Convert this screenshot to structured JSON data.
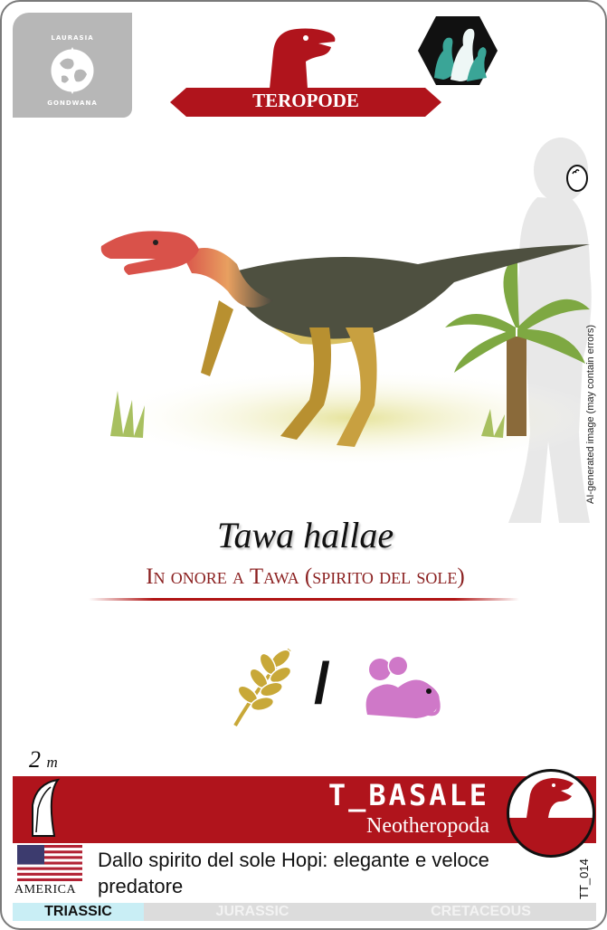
{
  "card": {
    "map_badge": {
      "top_label": "LAURASIA",
      "bottom_label": "GONDWANA",
      "icon": "globe-icon"
    },
    "category": {
      "label": "TEROPODE",
      "icon": "theropod-head-icon",
      "color": "#b0141c"
    },
    "behavior_icon": "herd-hexagon-icon",
    "egg_icon": "egg-icon",
    "ai_notice": "AI-generated image (may contain errors)",
    "scientific_name": "Tawa hallae",
    "name_meaning": "In onore a Tawa (spirito del sole)",
    "diet": {
      "icons": [
        "plant-leaf-icon",
        "mouse-icon"
      ],
      "separator": "/"
    },
    "size": {
      "value": "2",
      "unit": "m"
    },
    "group": {
      "name": "T_BASALE",
      "family": "Neotheropoda",
      "icon": "theropod-circle-icon"
    },
    "region": {
      "label": "AMERICA",
      "flag": "us-flag-icon"
    },
    "description": "Dallo spirito del sole Hopi: elegante e veloce predatore",
    "card_code": "TT_014",
    "periods": [
      {
        "label": "TRIASSIC",
        "active": true
      },
      {
        "label": "JURASSIC",
        "active": false
      },
      {
        "label": "CRETACEOUS",
        "active": false
      }
    ],
    "accent_color": "#b0141c"
  }
}
